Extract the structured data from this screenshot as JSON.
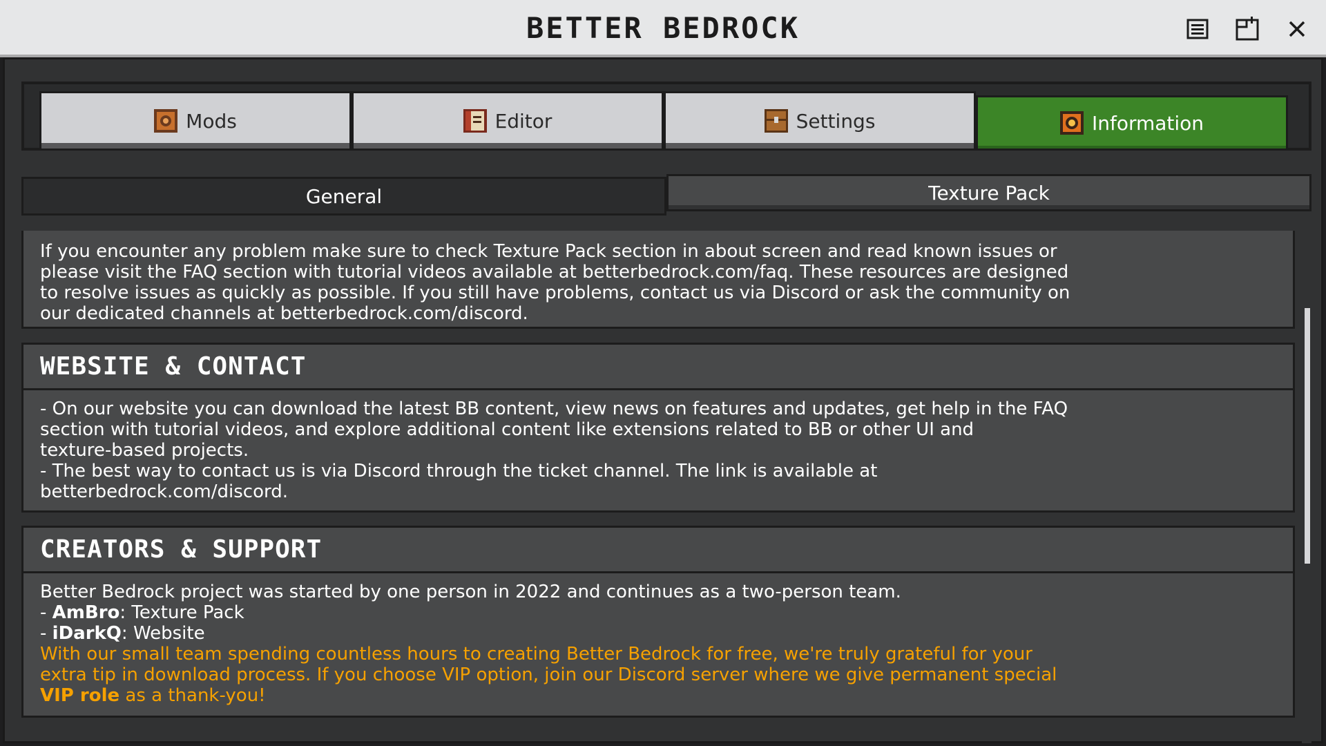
{
  "window": {
    "title": "BETTER BEDROCK",
    "controls": [
      "menu-icon",
      "window-icon",
      "close-icon"
    ]
  },
  "tabs": [
    {
      "label": "Mods",
      "icon": "gear-block-icon",
      "active": false
    },
    {
      "label": "Editor",
      "icon": "book-icon",
      "active": false
    },
    {
      "label": "Settings",
      "icon": "chest-icon",
      "active": false
    },
    {
      "label": "Information",
      "icon": "info-block-icon",
      "active": true
    }
  ],
  "subtabs": {
    "general": "General",
    "texture_pack": "Texture Pack"
  },
  "panels": {
    "intro": {
      "lines": [
        "If you encounter any problem make sure to check Texture Pack section in about screen and read known issues or",
        "please visit the FAQ section with tutorial videos available at betterbedrock.com/faq. These resources are designed",
        "to resolve issues as quickly as possible. If you still have problems, contact us via Discord or ask the community on",
        "our dedicated channels at betterbedrock.com/discord."
      ]
    },
    "website": {
      "title": "WEBSITE & CONTACT",
      "lines": [
        "- On our website you can download the latest BB content, view news on features and updates, get help in the FAQ",
        "section with tutorial videos, and explore additional content like extensions related to BB or other UI and",
        "texture-based projects.",
        "- The best way to contact us is via Discord through the ticket channel. The link is available at",
        "betterbedrock.com/discord."
      ]
    },
    "creators": {
      "title": "CREATORS & SUPPORT",
      "line1": "Better Bedrock project was started by one person in 2022 and continues as a two-person team.",
      "members": [
        {
          "prefix": "- ",
          "name": "AmBro",
          "role": ": Texture Pack"
        },
        {
          "prefix": "- ",
          "name": "iDarkQ",
          "role": ": Website"
        }
      ],
      "support_lines": [
        "With our small team spending countless hours to creating Better Bedrock for free, we're truly grateful for your",
        "extra tip in download process. If you choose VIP option, join our Discord server where we give permanent special"
      ],
      "vip_bold": "VIP role",
      "vip_rest": " as a thank-you!"
    }
  },
  "colors": {
    "accent_green": "#3c8527",
    "gold_text": "#f6a100",
    "panel": "#48494a"
  }
}
